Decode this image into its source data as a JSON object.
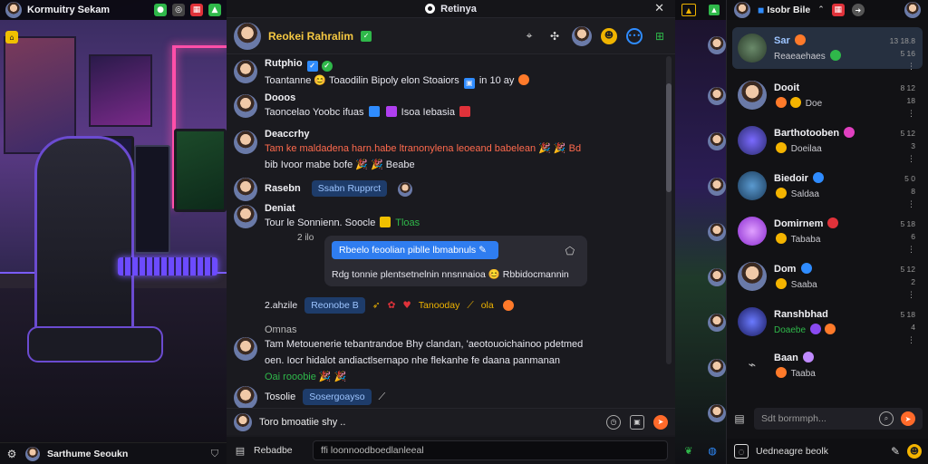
{
  "left": {
    "title": "Kormuitry Sekam",
    "bottom_label": "Sarthume Seoukn"
  },
  "chat": {
    "window_title": "Retinya",
    "header_name": "Reokei Rahralim",
    "messages": [
      {
        "author": "Rutphio",
        "text": "Toantanne 😊 Toaodilin Bipoly elon Stoaiors",
        "tail": "in 10 ay"
      },
      {
        "author": "Dooos",
        "text": "Taoncelao Yoobc ifuas",
        "tail": "Isoa Iebasia"
      },
      {
        "author": "Deaccrhy",
        "line1": "Tam ke maldadena harn.habe ltranonylena leoeand babelean 🎉 🎉 Bd",
        "line2": "bib Ivoor mabe bofe 🎉 🎉 Beabe"
      },
      {
        "author": "Rasebn",
        "pill": "Ssabn Rupprct"
      },
      {
        "author": "Deniat",
        "text": "Tour le  Sonnienn. Soocle",
        "tail": "Tloas",
        "time": "2 ilo"
      },
      {
        "author": "Omnas",
        "line1": "Tam Metouenerie tebantrandoe Bhy clandan, 'aeotouoichainoo pdetmed",
        "line2": "oen. Iocr hidalot andiactlsernapo nhe flekanhe fe daana panmanan",
        "line3": "Oai rooobie 🎉 🎉"
      },
      {
        "author": "Tosolie",
        "pill": "Sosergoayso"
      }
    ],
    "reply_card": {
      "button": "Rbeelo feoolian piblle lbmabnuls",
      "line": "Rdg tonnie plentsetnelnin nnsnnaioa 😊 Rbbidocmannin"
    },
    "inline_row": {
      "label": "2.ahzile",
      "pill": "Reonobe B",
      "text": "Tanooday",
      "tail": "ola"
    },
    "composer_placeholder": "Toro bmoatiie shy ..",
    "footer_label": "Rebadbe",
    "footer_input": "ffi loonnoodboedlanleeal"
  },
  "right": {
    "top_label": "Isobr Bile",
    "contacts": [
      {
        "name": "Sar",
        "sub": "Reaeaehaes",
        "time1": "13 18.8",
        "time2": "5 16"
      },
      {
        "name": "Dooit",
        "sub": "Doe",
        "time1": "8 12",
        "time2": "18"
      },
      {
        "name": "Barthotooben",
        "sub": "Doeilaa",
        "time1": "5 12",
        "time2": "3"
      },
      {
        "name": "Biedoir",
        "sub": "Saldaa",
        "time1": "5 0",
        "time2": "8"
      },
      {
        "name": "Domirnem",
        "sub": "Tababa",
        "time1": "5 18",
        "time2": "6"
      },
      {
        "name": "Dom",
        "sub": "Saaba",
        "time1": "5 12",
        "time2": "2"
      },
      {
        "name": "Ranshbhad",
        "sub": "Doaebe",
        "time1": "5 18",
        "time2": "4"
      },
      {
        "name": "Baan",
        "sub": "Taaba",
        "time1": "",
        "time2": ""
      }
    ],
    "search_placeholder": "Sdt bormmph...",
    "bottom_label": "Uedneagre beolk"
  }
}
